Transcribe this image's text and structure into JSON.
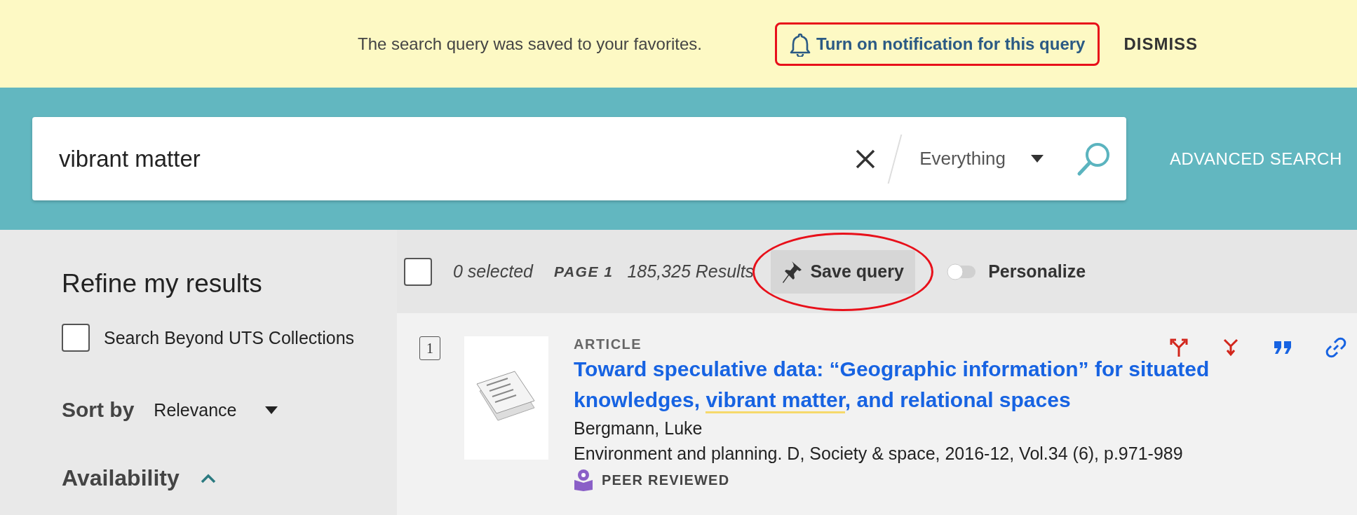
{
  "banner": {
    "message": "The search query was saved to your favorites.",
    "notification_link": {
      "label": "Turn on notification for this query",
      "highlighted": true
    },
    "dismiss": "DISMISS"
  },
  "search": {
    "value": "vibrant matter",
    "scope": "Everything",
    "advanced_search": "ADVANCED SEARCH"
  },
  "sidebar": {
    "title": "Refine my results",
    "search_beyond": {
      "label": "Search Beyond UTS Collections",
      "checked": false
    },
    "sort_by": {
      "label": "Sort by",
      "value": "Relevance"
    },
    "availability": {
      "label": "Availability",
      "expanded": true
    }
  },
  "toolbar": {
    "select_all": {
      "checked": false
    },
    "selected_count": "0 selected",
    "page": "PAGE 1",
    "results": "185,325 Results",
    "save_query": {
      "label": "Save query",
      "highlighted": true
    },
    "personalize": {
      "label": "Personalize",
      "on": false
    }
  },
  "results": [
    {
      "number": "1",
      "type": "ARTICLE",
      "title_parts": [
        {
          "text": "Toward speculative data: “Geographic information” for situated knowledges, ",
          "highlighted": false
        },
        {
          "text": "vibrant matter",
          "highlighted": true
        },
        {
          "text": ", and relational spaces",
          "highlighted": false
        }
      ],
      "author": "Bergmann, Luke",
      "source": "Environment and planning. D, Society & space, 2016-12, Vol.34 (6), p.971-989",
      "peer_reviewed": "PEER REVIEWED"
    }
  ]
}
